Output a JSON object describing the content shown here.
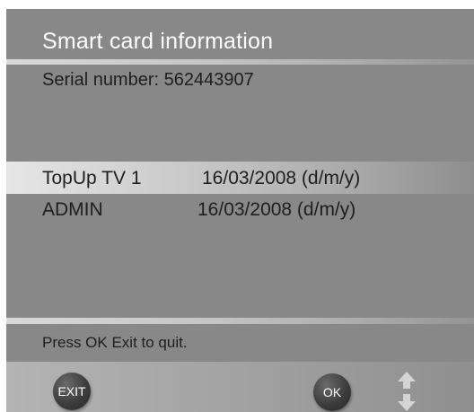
{
  "screen": {
    "title": "Smart card information",
    "serial_label": "Serial number: ",
    "serial_value": "562443907"
  },
  "entries": [
    {
      "name": "TopUp TV 1",
      "date": "16/03/2008 (d/m/y)",
      "selected": true
    },
    {
      "name": "ADMIN",
      "date": "16/03/2008 (d/m/y)",
      "selected": false
    }
  ],
  "footer": {
    "hint": "Press OK Exit to quit.",
    "exit_label": "EXIT",
    "ok_label": "OK"
  },
  "icons": {
    "navigate": "up-down-arrows-icon"
  }
}
